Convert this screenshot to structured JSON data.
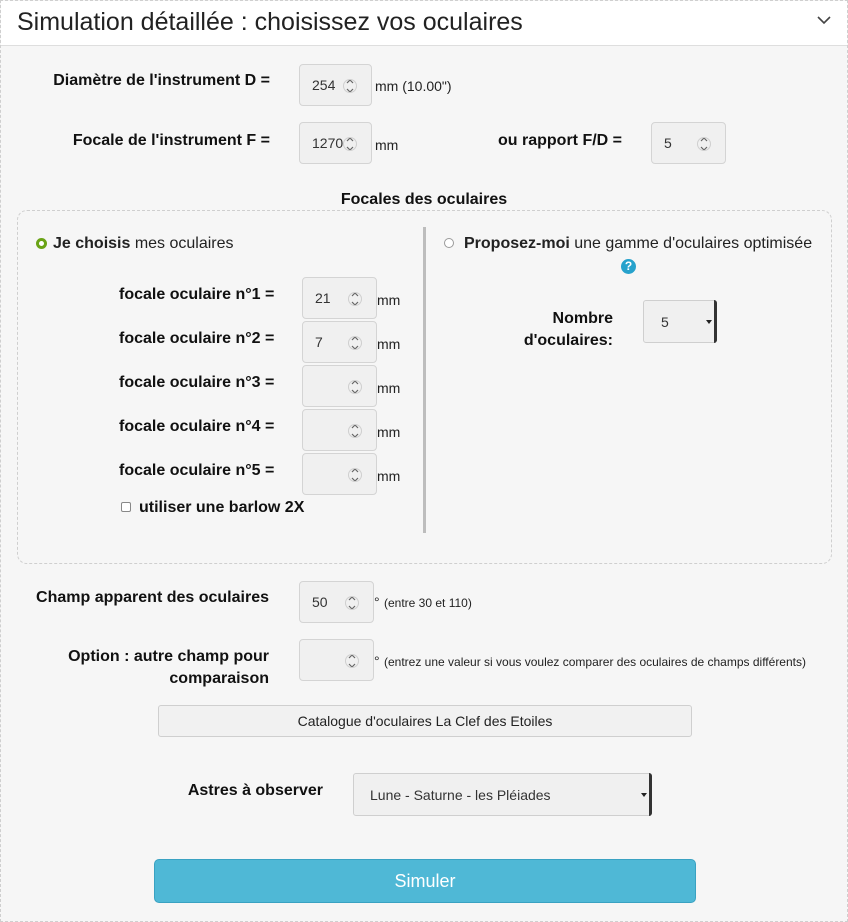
{
  "header": {
    "title": "Simulation détaillée : choisissez vos oculaires",
    "toggle_icon": "chevron-down-icon"
  },
  "instrument": {
    "diameter_label": "Diamètre de l'instrument D =",
    "diameter_value": "254",
    "diameter_unit": "mm (10.00\")",
    "focal_label": "Focale de l'instrument F =",
    "focal_value": "1270",
    "focal_unit": "mm",
    "ratio_label": "ou rapport F/D =",
    "ratio_value": "5"
  },
  "eyepieces_section": {
    "title": "Focales des oculaires",
    "choose": {
      "bold": "Je choisis",
      "rest": " mes oculaires",
      "selected": true
    },
    "propose": {
      "bold": "Proposez-moi",
      "rest": " une gamme d'oculaires optimisée",
      "selected": false,
      "help_icon": "question-icon",
      "help_glyph": "?"
    },
    "focals": [
      {
        "label": "focale oculaire n°1 =",
        "value": "21",
        "unit": "mm"
      },
      {
        "label": "focale oculaire n°2 =",
        "value": "7",
        "unit": "mm"
      },
      {
        "label": "focale oculaire n°3 =",
        "value": "",
        "unit": "mm"
      },
      {
        "label": "focale oculaire n°4 =",
        "value": "",
        "unit": "mm"
      },
      {
        "label": "focale oculaire n°5 =",
        "value": "",
        "unit": "mm"
      }
    ],
    "barlow_label": "utiliser une barlow 2X",
    "barlow_checked": false,
    "count_label_1": "Nombre",
    "count_label_2": "d'oculaires:",
    "count_value": "5"
  },
  "apparent_field": {
    "label": "Champ apparent des oculaires",
    "value": "50",
    "unit": "°",
    "hint": "(entre 30 et 110)"
  },
  "option_field": {
    "label_1": "Option : autre champ pour",
    "label_2": "comparaison",
    "value": "",
    "unit": "°",
    "hint": "(entrez une valeur si vous voulez comparer des oculaires de champs différents)"
  },
  "catalog_button": "Catalogue d'oculaires La Clef des Etoiles",
  "targets": {
    "label": "Astres à observer",
    "value": "Lune - Saturne - les Pléiades"
  },
  "simulate_button": "Simuler",
  "colors": {
    "accent": "#4fb8d6",
    "radio_on": "#6aa316",
    "help": "#27a2cc"
  }
}
